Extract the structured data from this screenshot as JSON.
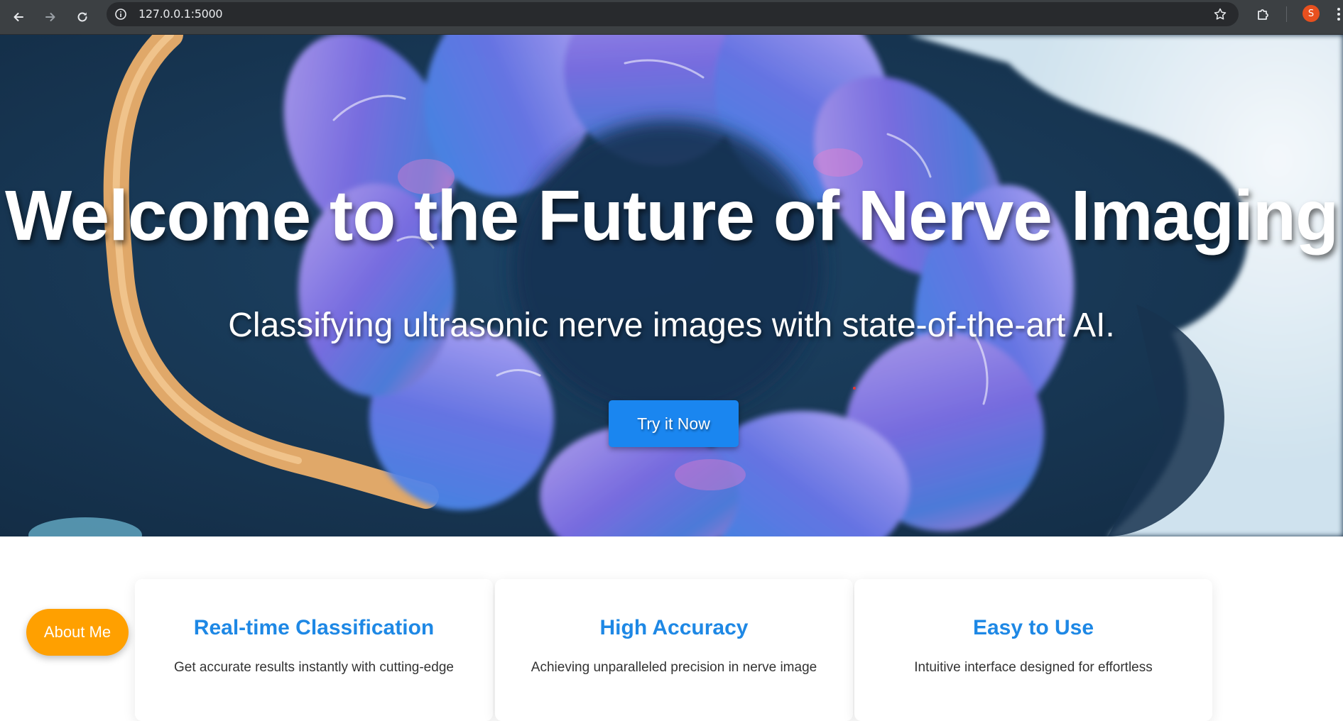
{
  "browser": {
    "url": "127.0.0.1:5000",
    "profile_initial": "S"
  },
  "hero": {
    "title": "Welcome to the Future of Nerve Imaging",
    "subtitle": "Classifying ultrasonic nerve images with state-of-the-art AI.",
    "cta_label": "Try it Now"
  },
  "features": [
    {
      "title": "Real-time Classification",
      "text": "Get accurate results instantly with cutting-edge"
    },
    {
      "title": "High Accuracy",
      "text": "Achieving unparalleled precision in nerve image"
    },
    {
      "title": "Easy to Use",
      "text": "Intuitive interface designed for effortless"
    }
  ],
  "about_label": "About Me",
  "colors": {
    "accent_blue": "#1a86f0",
    "heading_blue": "#1e88e5",
    "about_orange": "#ffa000",
    "chrome_bg": "#3c4043"
  },
  "icons": [
    "back-arrow-icon",
    "forward-arrow-icon",
    "reload-icon",
    "info-icon",
    "star-icon",
    "extensions-icon",
    "menu-dots-icon"
  ]
}
